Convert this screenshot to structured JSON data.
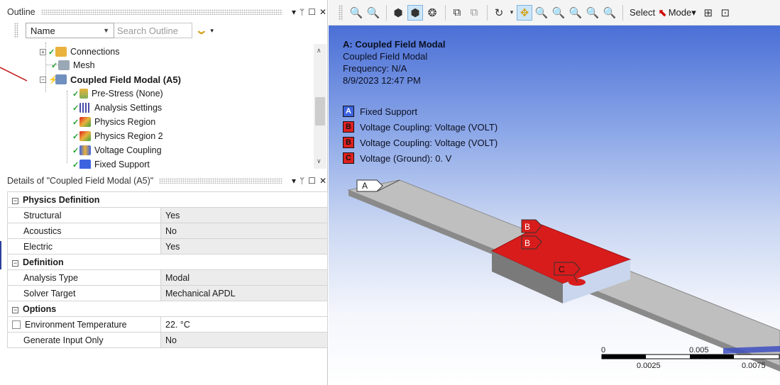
{
  "outline": {
    "title": "Outline",
    "controls": [
      "▾",
      "ᛘ",
      "☐",
      "✕"
    ],
    "name_column": "Name",
    "search_placeholder": "Search Outline",
    "tree": [
      {
        "label": "Connections",
        "icon": "connections-icon"
      },
      {
        "label": "Mesh",
        "icon": "mesh-icon"
      },
      {
        "label": "Coupled Field Modal (A5)",
        "icon": "analysis-icon",
        "bold": true
      },
      {
        "label": "Pre-Stress (None)",
        "icon": "prestress-icon"
      },
      {
        "label": "Analysis Settings",
        "icon": "analysis-settings-icon"
      },
      {
        "label": "Physics Region",
        "icon": "physics-region-icon"
      },
      {
        "label": "Physics Region 2",
        "icon": "physics-region-icon"
      },
      {
        "label": "Voltage Coupling",
        "icon": "voltage-coupling-icon"
      },
      {
        "label": "Fixed Support",
        "icon": "fixed-support-icon"
      }
    ]
  },
  "details": {
    "title": "Details of \"Coupled Field Modal (A5)\"",
    "sections": [
      {
        "name": "Physics Definition",
        "rows": [
          {
            "name": "Structural",
            "value": "Yes"
          },
          {
            "name": "Acoustics",
            "value": "No"
          },
          {
            "name": "Electric",
            "value": "Yes"
          }
        ]
      },
      {
        "name": "Definition",
        "rows": [
          {
            "name": "Analysis Type",
            "value": "Modal"
          },
          {
            "name": "Solver Target",
            "value": "Mechanical APDL"
          }
        ]
      },
      {
        "name": "Options",
        "rows": [
          {
            "name": "Environment Temperature",
            "value": "22. °C",
            "checkbox": true
          },
          {
            "name": "Generate Input Only",
            "value": "No"
          }
        ]
      }
    ]
  },
  "toolbar": {
    "select_label": "Select",
    "mode_label": "Mode▾"
  },
  "viewport": {
    "info_title": "A: Coupled Field Modal",
    "info_lines": [
      "Coupled Field Modal",
      "Frequency: N/A",
      "8/9/2023 12:47 PM"
    ],
    "legend": [
      {
        "key": "A",
        "label": "Fixed Support",
        "color": "#3d63e0"
      },
      {
        "key": "B",
        "label": "Voltage Coupling: Voltage (VOLT)",
        "color": "#e02020"
      },
      {
        "key": "B",
        "label": "Voltage Coupling: Voltage (VOLT)",
        "color": "#e02020"
      },
      {
        "key": "C",
        "label": "Voltage (Ground): 0. V",
        "color": "#e02020"
      }
    ],
    "scale": {
      "top_labels": [
        "0",
        "0.005"
      ],
      "bottom_labels": [
        "0.0025",
        "0.0075"
      ]
    }
  },
  "colors": {
    "accent_blue": "#4a6fd6",
    "load_red": "#e02020",
    "check_green": "#1e9e2a"
  }
}
